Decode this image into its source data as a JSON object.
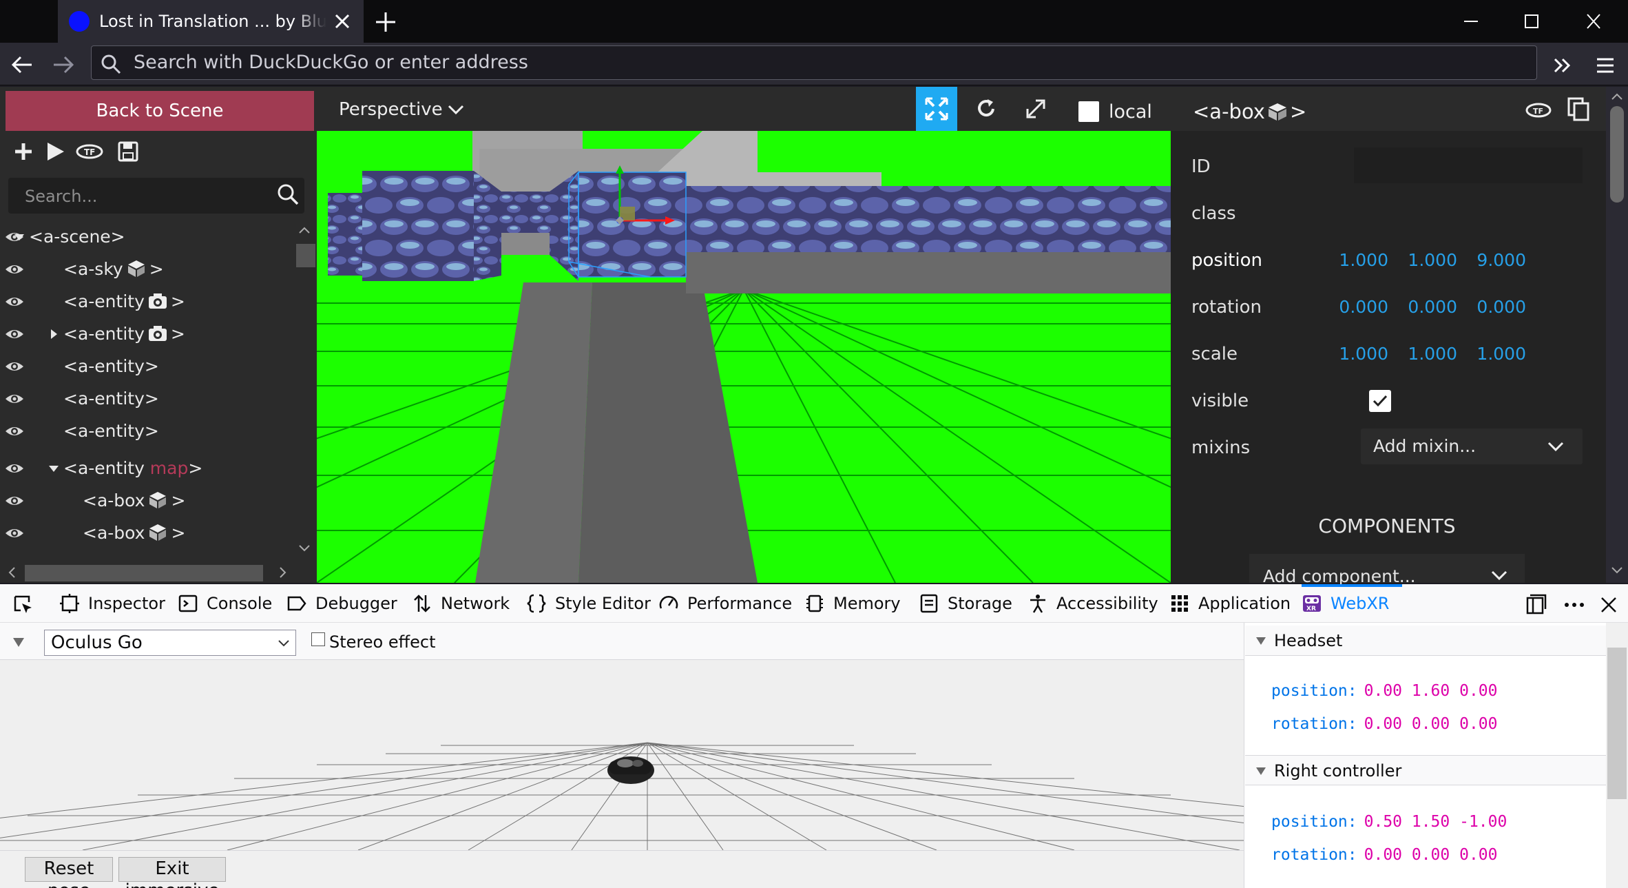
{
  "browser": {
    "tab_title": "Lost in Translation ... by Blue Do",
    "url_placeholder": "Search with DuckDuckGo or enter address"
  },
  "inspector": {
    "back_label": "Back to Scene",
    "search_placeholder": "Search...",
    "tree": [
      {
        "label": "<a-scene>",
        "expanded": true
      },
      {
        "label": "<a-sky",
        "icon": "cube-icon",
        "end": ">"
      },
      {
        "label": "<a-entity",
        "icon": "camera-icon",
        "end": ">"
      },
      {
        "label": "<a-entity",
        "icon": "camera-icon",
        "end": ">",
        "collapsed": true
      },
      {
        "label": "<a-entity>"
      },
      {
        "label": "<a-entity>"
      },
      {
        "label": "<a-entity>"
      },
      {
        "label": "<a-entity",
        "id": "map",
        "end": ">",
        "expanded": true
      },
      {
        "label": "<a-box",
        "icon": "cube-icon",
        "end": ">"
      },
      {
        "label": "<a-box",
        "icon": "cube-icon",
        "end": ">"
      }
    ],
    "camera_mode": "Perspective",
    "local_label": "local",
    "selected_title": "<a-box",
    "selected_title_end": ">",
    "properties": {
      "id_label": "ID",
      "class_label": "class",
      "position_label": "position",
      "position": [
        "1.000",
        "1.000",
        "9.000"
      ],
      "rotation_label": "rotation",
      "rotation": [
        "0.000",
        "0.000",
        "0.000"
      ],
      "scale_label": "scale",
      "scale": [
        "1.000",
        "1.000",
        "1.000"
      ],
      "visible_label": "visible",
      "visible": true,
      "mixins_label": "mixins",
      "mixins_placeholder": "Add mixin..."
    },
    "components_title": "COMPONENTS",
    "add_component": "Add component..."
  },
  "devtools": {
    "tabs": [
      "Inspector",
      "Console",
      "Debugger",
      "Network",
      "Style Editor",
      "Performance",
      "Memory",
      "Storage",
      "Accessibility",
      "Application",
      "WebXR"
    ],
    "active_tab": "WebXR",
    "webxr": {
      "device": "Oculus Go",
      "stereo_label": "Stereo effect",
      "reset_pose": "Reset pose",
      "exit_immersive": "Exit immersive",
      "headset_title": "Headset",
      "headset_position_key": "position:",
      "headset_position": "0.00 1.60 0.00",
      "headset_rotation_key": "rotation:",
      "headset_rotation": "0.00 0.00 0.00",
      "controller_title": "Right controller",
      "controller_position_key": "position:",
      "controller_position": "0.50 1.50 -1.00",
      "controller_rotation_key": "rotation:",
      "controller_rotation": "0.00 0.00 0.00"
    }
  },
  "colors": {
    "accent": "#1faaf2",
    "back_button": "#a03b52",
    "scene_ground": "#1cff00",
    "value_blue": "#26a0e8"
  }
}
